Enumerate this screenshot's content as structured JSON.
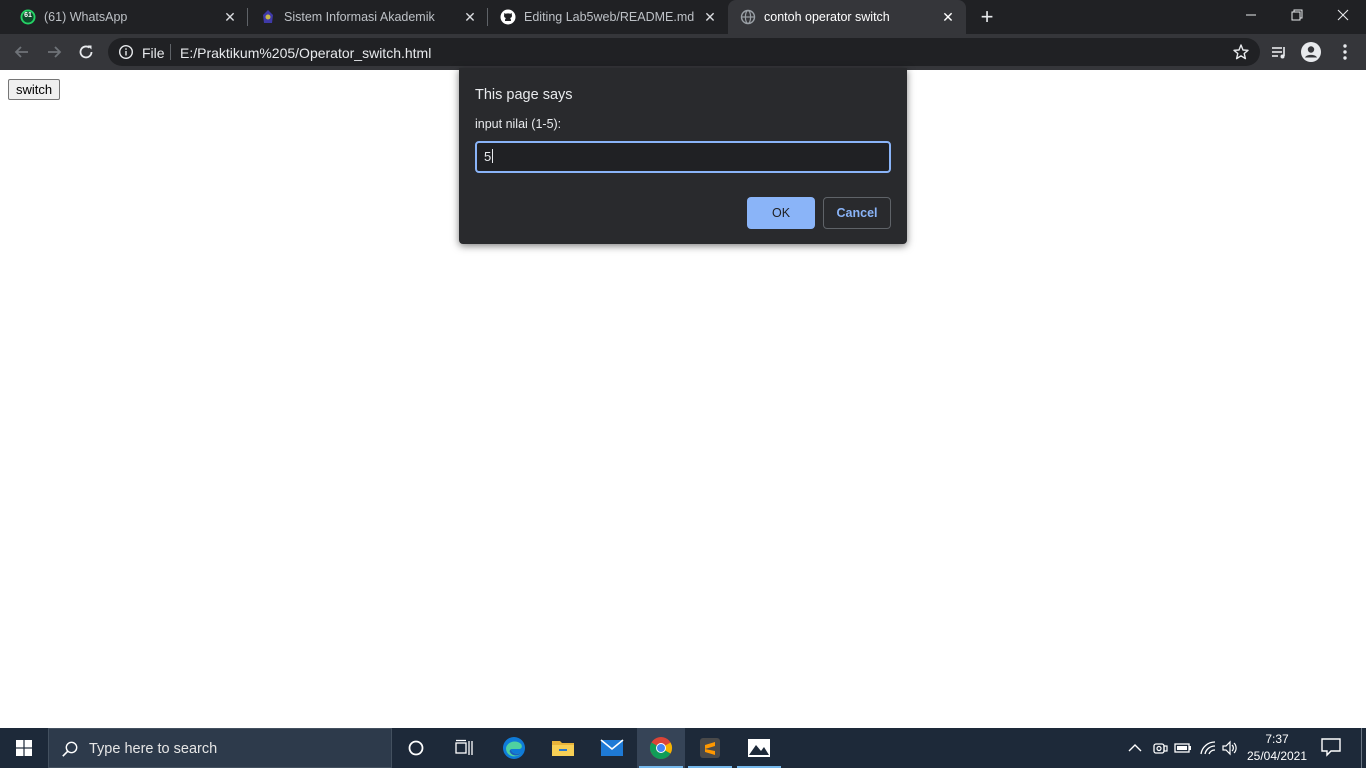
{
  "browser": {
    "tabs": [
      {
        "title": "(61) WhatsApp",
        "badge": "61",
        "favicon": "whatsapp-icon",
        "active": false
      },
      {
        "title": "Sistem Informasi Akademik",
        "favicon": "campus-logo-icon",
        "active": false
      },
      {
        "title": "Editing Lab5web/README.md at",
        "favicon": "github-icon",
        "active": false
      },
      {
        "title": "contoh operator switch",
        "favicon": "globe-icon",
        "active": true
      }
    ],
    "close_glyph": "✕",
    "new_tab_glyph": "+",
    "address": {
      "scheme_label": "File",
      "url": "E:/Praktikum%205/Operator_switch.html"
    },
    "colors": {
      "frame": "#202124",
      "toolbar": "#35363a",
      "accent": "#8ab4f8"
    }
  },
  "page": {
    "button_label": "switch"
  },
  "dialog": {
    "title": "This page says",
    "message": "input nilai (1-5):",
    "input_value": "5",
    "ok_label": "OK",
    "cancel_label": "Cancel"
  },
  "taskbar": {
    "search_placeholder": "Type here to search",
    "apps": [
      "cortana-icon",
      "task-view-icon",
      "edge-icon",
      "file-explorer-icon",
      "mail-icon",
      "chrome-icon",
      "sublime-text-icon",
      "photos-icon"
    ],
    "clock_time": "7:37",
    "clock_date": "25/04/2021",
    "colors": {
      "background": "#1d2939",
      "running_indicator": "#76b9ed"
    }
  }
}
